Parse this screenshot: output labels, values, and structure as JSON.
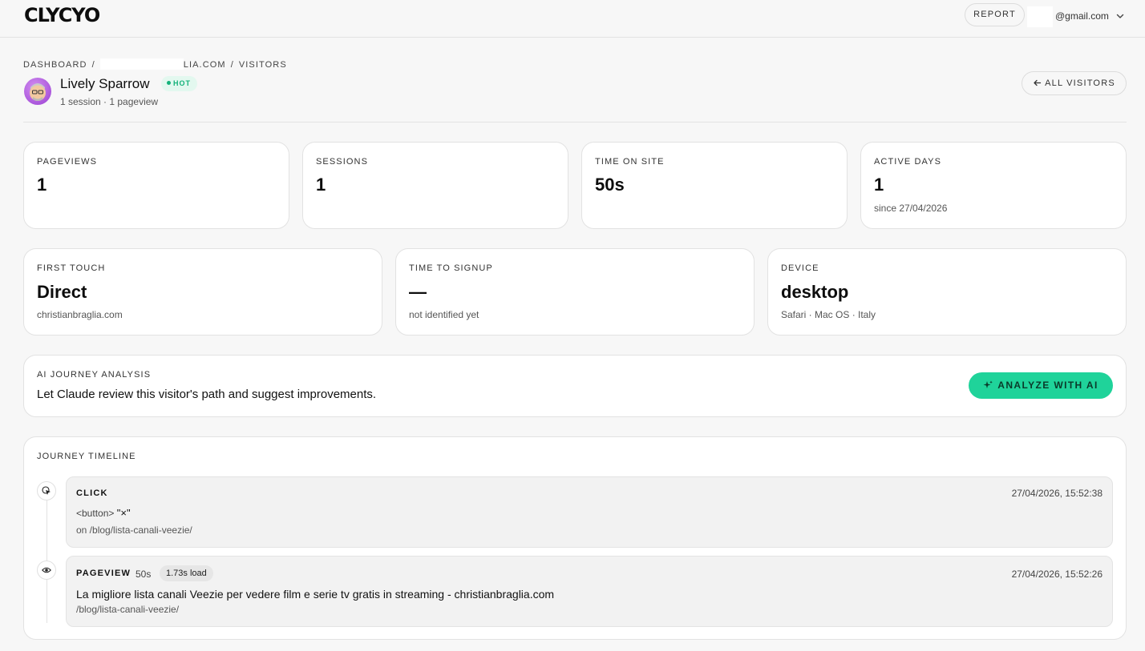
{
  "app": {
    "logo": "CLYCYO",
    "report_label": "REPORT",
    "account_email": "@gmail.com"
  },
  "breadcrumb": {
    "dashboard": "DASHBOARD",
    "site": "LIA.COM",
    "visitors": "VISITORS"
  },
  "visitor": {
    "name": "Lively Sparrow",
    "badge": "HOT",
    "meta": "1 session · 1 pageview",
    "all_visitors_label": "ALL VISITORS"
  },
  "stats": [
    {
      "label": "PAGEVIEWS",
      "value": "1",
      "sub": ""
    },
    {
      "label": "SESSIONS",
      "value": "1",
      "sub": ""
    },
    {
      "label": "TIME ON SITE",
      "value": "50s",
      "sub": ""
    },
    {
      "label": "ACTIVE DAYS",
      "value": "1",
      "sub": "since 27/04/2026"
    }
  ],
  "details": [
    {
      "label": "FIRST TOUCH",
      "value": "Direct",
      "sub": "christianbraglia.com"
    },
    {
      "label": "TIME TO SIGNUP",
      "value": "—",
      "sub": "not identified yet"
    },
    {
      "label": "DEVICE",
      "value": "desktop",
      "sub": "Safari · Mac OS · Italy"
    }
  ],
  "ai": {
    "label": "AI JOURNEY ANALYSIS",
    "text": "Let Claude review this visitor's path and suggest improvements.",
    "button": "ANALYZE WITH AI"
  },
  "timeline": {
    "label": "JOURNEY TIMELINE",
    "events": [
      {
        "type": "CLICK",
        "time": "27/04/2026, 15:52:38",
        "element": "<button>",
        "text": "\"×\"",
        "path": "on /blog/lista-canali-veezie/"
      },
      {
        "type": "PAGEVIEW",
        "duration": "50s",
        "load": "1.73s load",
        "time": "27/04/2026, 15:52:26",
        "title": "La migliore lista canali Veezie per vedere film e serie tv gratis in streaming - christianbraglia.com",
        "path": "/blog/lista-canali-veezie/"
      }
    ]
  },
  "colors": {
    "accent": "#1fd39a",
    "hot": "#14b27a",
    "background": "#f7f7f7"
  },
  "icons": [
    "chevron-down-icon",
    "arrow-left-icon",
    "sparkle-icon",
    "cursor-click-icon",
    "eye-icon"
  ]
}
